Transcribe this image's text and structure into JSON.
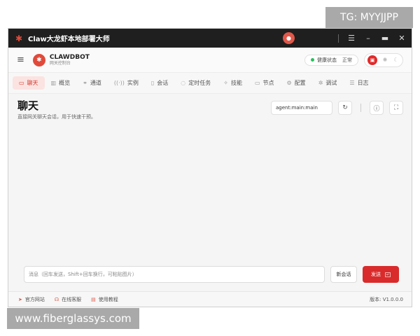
{
  "watermarks": {
    "top": "TG: MYYJJPP",
    "bottom": "www.fiberglassys.com"
  },
  "titlebar": {
    "title": "Claw大龙虾本地部署大师",
    "logo_icon": "crab-icon"
  },
  "header": {
    "brand_name": "CLAWDBOT",
    "brand_sub": "网关控制台",
    "health_label": "健康状态",
    "health_status": "正常"
  },
  "nav": [
    {
      "label": "聊天",
      "icon": "chat-icon",
      "active": true
    },
    {
      "label": "概览",
      "icon": "chart-icon"
    },
    {
      "label": "通道",
      "icon": "link-icon"
    },
    {
      "label": "实例",
      "icon": "signal-icon"
    },
    {
      "label": "会话",
      "icon": "document-icon"
    },
    {
      "label": "定时任务",
      "icon": "clock-icon"
    },
    {
      "label": "技能",
      "icon": "sparkle-icon"
    },
    {
      "label": "节点",
      "icon": "monitor-icon"
    },
    {
      "label": "配置",
      "icon": "gear-icon"
    },
    {
      "label": "调试",
      "icon": "bug-icon"
    },
    {
      "label": "日志",
      "icon": "log-icon"
    }
  ],
  "page": {
    "title": "聊天",
    "subtitle": "直接网关聊天会话，用于快速干预。",
    "session_value": "agent:main:main"
  },
  "composer": {
    "placeholder": "消息（回车发送，Shift+回车换行，可粘贴图片）",
    "new_label": "新会话",
    "send_label": "发送"
  },
  "footer": {
    "official_site": "官方网站",
    "online_support": "在线客服",
    "tutorial": "使用教程",
    "version": "版本: V1.0.0.0"
  }
}
